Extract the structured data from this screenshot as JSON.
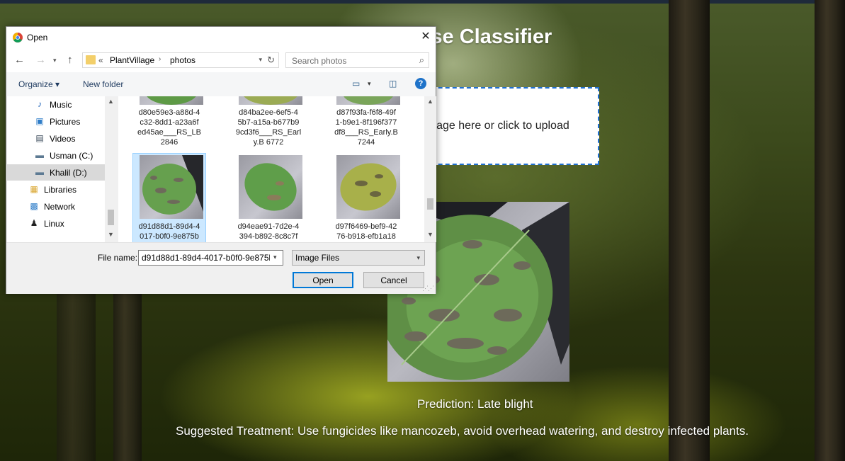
{
  "page": {
    "title": "sease Classifier",
    "dropzone_text": "p your image here or click to upload",
    "prediction": "Prediction: Late blight",
    "treatment": "Suggested Treatment: Use fungicides like mancozeb, avoid overhead watering, and destroy infected plants."
  },
  "dialog": {
    "title": "Open",
    "close_icon": "close-icon",
    "address": {
      "overflow": "«",
      "crumbs": [
        "PlantVillage",
        "photos"
      ],
      "sep": "›"
    },
    "search_placeholder": "Search photos",
    "toolbar": {
      "organize": "Organize ▾",
      "new_folder": "New folder",
      "view_dd": "▾"
    },
    "nav_items": [
      {
        "label": "Music",
        "icon": "music-icon",
        "glyph": "♪"
      },
      {
        "label": "Pictures",
        "icon": "pictures-icon",
        "glyph": "▣"
      },
      {
        "label": "Videos",
        "icon": "videos-icon",
        "glyph": "▤"
      },
      {
        "label": "Usman (C:)",
        "icon": "drive-icon",
        "glyph": "▬"
      },
      {
        "label": "Khalil (D:)",
        "icon": "drive-icon",
        "glyph": "▬",
        "selected": true
      },
      {
        "label": "Libraries",
        "icon": "libraries-icon",
        "glyph": "▦"
      },
      {
        "label": "Network",
        "icon": "network-icon",
        "glyph": "▩"
      },
      {
        "label": "Linux",
        "icon": "linux-icon",
        "glyph": "♟"
      }
    ],
    "files": [
      {
        "line1": "d80e59e3-a88d-4",
        "line2": "c32-8dd1-a23a6f",
        "line3": "ed45ae___RS_LB",
        "line4": "2846"
      },
      {
        "line1": "d84ba2ee-6ef5-4",
        "line2": "5b7-a15a-b677b9",
        "line3": "9cd3f6___RS_Earl",
        "line4": "y.B 6772"
      },
      {
        "line1": "d87f93fa-f6f8-49f",
        "line2": "1-b9e1-8f196f377",
        "line3": "df8___RS_Early.B",
        "line4": "7244"
      },
      {
        "line1": "d91d88d1-89d4-4",
        "line2": "017-b0f0-9e875b",
        "selected": true
      },
      {
        "line1": "d94eae91-7d2e-4",
        "line2": "394-b892-8c8c7f"
      },
      {
        "line1": "d97f6469-bef9-42",
        "line2": "76-b918-efb1a18"
      }
    ],
    "file_name_label": "File name:",
    "file_name_value": "d91d88d1-89d4-4017-b0f0-9e875b",
    "file_type": "Image Files",
    "open_label": "Open",
    "cancel_label": "Cancel"
  },
  "colors": {
    "accent": "#0078d7",
    "dropzone_border": "#1f6fd1",
    "selected_tile": "#cce8ff",
    "help": "#1f73c9"
  }
}
